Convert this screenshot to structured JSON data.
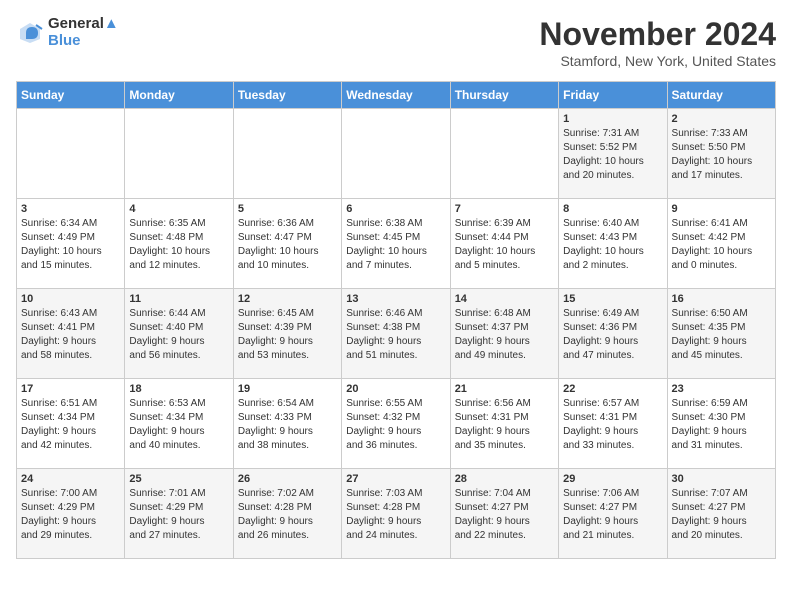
{
  "logo": {
    "line1": "General",
    "line2": "Blue"
  },
  "title": "November 2024",
  "location": "Stamford, New York, United States",
  "weekdays": [
    "Sunday",
    "Monday",
    "Tuesday",
    "Wednesday",
    "Thursday",
    "Friday",
    "Saturday"
  ],
  "weeks": [
    [
      {
        "day": "",
        "detail": ""
      },
      {
        "day": "",
        "detail": ""
      },
      {
        "day": "",
        "detail": ""
      },
      {
        "day": "",
        "detail": ""
      },
      {
        "day": "",
        "detail": ""
      },
      {
        "day": "1",
        "detail": "Sunrise: 7:31 AM\nSunset: 5:52 PM\nDaylight: 10 hours\nand 20 minutes."
      },
      {
        "day": "2",
        "detail": "Sunrise: 7:33 AM\nSunset: 5:50 PM\nDaylight: 10 hours\nand 17 minutes."
      }
    ],
    [
      {
        "day": "3",
        "detail": "Sunrise: 6:34 AM\nSunset: 4:49 PM\nDaylight: 10 hours\nand 15 minutes."
      },
      {
        "day": "4",
        "detail": "Sunrise: 6:35 AM\nSunset: 4:48 PM\nDaylight: 10 hours\nand 12 minutes."
      },
      {
        "day": "5",
        "detail": "Sunrise: 6:36 AM\nSunset: 4:47 PM\nDaylight: 10 hours\nand 10 minutes."
      },
      {
        "day": "6",
        "detail": "Sunrise: 6:38 AM\nSunset: 4:45 PM\nDaylight: 10 hours\nand 7 minutes."
      },
      {
        "day": "7",
        "detail": "Sunrise: 6:39 AM\nSunset: 4:44 PM\nDaylight: 10 hours\nand 5 minutes."
      },
      {
        "day": "8",
        "detail": "Sunrise: 6:40 AM\nSunset: 4:43 PM\nDaylight: 10 hours\nand 2 minutes."
      },
      {
        "day": "9",
        "detail": "Sunrise: 6:41 AM\nSunset: 4:42 PM\nDaylight: 10 hours\nand 0 minutes."
      }
    ],
    [
      {
        "day": "10",
        "detail": "Sunrise: 6:43 AM\nSunset: 4:41 PM\nDaylight: 9 hours\nand 58 minutes."
      },
      {
        "day": "11",
        "detail": "Sunrise: 6:44 AM\nSunset: 4:40 PM\nDaylight: 9 hours\nand 56 minutes."
      },
      {
        "day": "12",
        "detail": "Sunrise: 6:45 AM\nSunset: 4:39 PM\nDaylight: 9 hours\nand 53 minutes."
      },
      {
        "day": "13",
        "detail": "Sunrise: 6:46 AM\nSunset: 4:38 PM\nDaylight: 9 hours\nand 51 minutes."
      },
      {
        "day": "14",
        "detail": "Sunrise: 6:48 AM\nSunset: 4:37 PM\nDaylight: 9 hours\nand 49 minutes."
      },
      {
        "day": "15",
        "detail": "Sunrise: 6:49 AM\nSunset: 4:36 PM\nDaylight: 9 hours\nand 47 minutes."
      },
      {
        "day": "16",
        "detail": "Sunrise: 6:50 AM\nSunset: 4:35 PM\nDaylight: 9 hours\nand 45 minutes."
      }
    ],
    [
      {
        "day": "17",
        "detail": "Sunrise: 6:51 AM\nSunset: 4:34 PM\nDaylight: 9 hours\nand 42 minutes."
      },
      {
        "day": "18",
        "detail": "Sunrise: 6:53 AM\nSunset: 4:34 PM\nDaylight: 9 hours\nand 40 minutes."
      },
      {
        "day": "19",
        "detail": "Sunrise: 6:54 AM\nSunset: 4:33 PM\nDaylight: 9 hours\nand 38 minutes."
      },
      {
        "day": "20",
        "detail": "Sunrise: 6:55 AM\nSunset: 4:32 PM\nDaylight: 9 hours\nand 36 minutes."
      },
      {
        "day": "21",
        "detail": "Sunrise: 6:56 AM\nSunset: 4:31 PM\nDaylight: 9 hours\nand 35 minutes."
      },
      {
        "day": "22",
        "detail": "Sunrise: 6:57 AM\nSunset: 4:31 PM\nDaylight: 9 hours\nand 33 minutes."
      },
      {
        "day": "23",
        "detail": "Sunrise: 6:59 AM\nSunset: 4:30 PM\nDaylight: 9 hours\nand 31 minutes."
      }
    ],
    [
      {
        "day": "24",
        "detail": "Sunrise: 7:00 AM\nSunset: 4:29 PM\nDaylight: 9 hours\nand 29 minutes."
      },
      {
        "day": "25",
        "detail": "Sunrise: 7:01 AM\nSunset: 4:29 PM\nDaylight: 9 hours\nand 27 minutes."
      },
      {
        "day": "26",
        "detail": "Sunrise: 7:02 AM\nSunset: 4:28 PM\nDaylight: 9 hours\nand 26 minutes."
      },
      {
        "day": "27",
        "detail": "Sunrise: 7:03 AM\nSunset: 4:28 PM\nDaylight: 9 hours\nand 24 minutes."
      },
      {
        "day": "28",
        "detail": "Sunrise: 7:04 AM\nSunset: 4:27 PM\nDaylight: 9 hours\nand 22 minutes."
      },
      {
        "day": "29",
        "detail": "Sunrise: 7:06 AM\nSunset: 4:27 PM\nDaylight: 9 hours\nand 21 minutes."
      },
      {
        "day": "30",
        "detail": "Sunrise: 7:07 AM\nSunset: 4:27 PM\nDaylight: 9 hours\nand 20 minutes."
      }
    ]
  ]
}
